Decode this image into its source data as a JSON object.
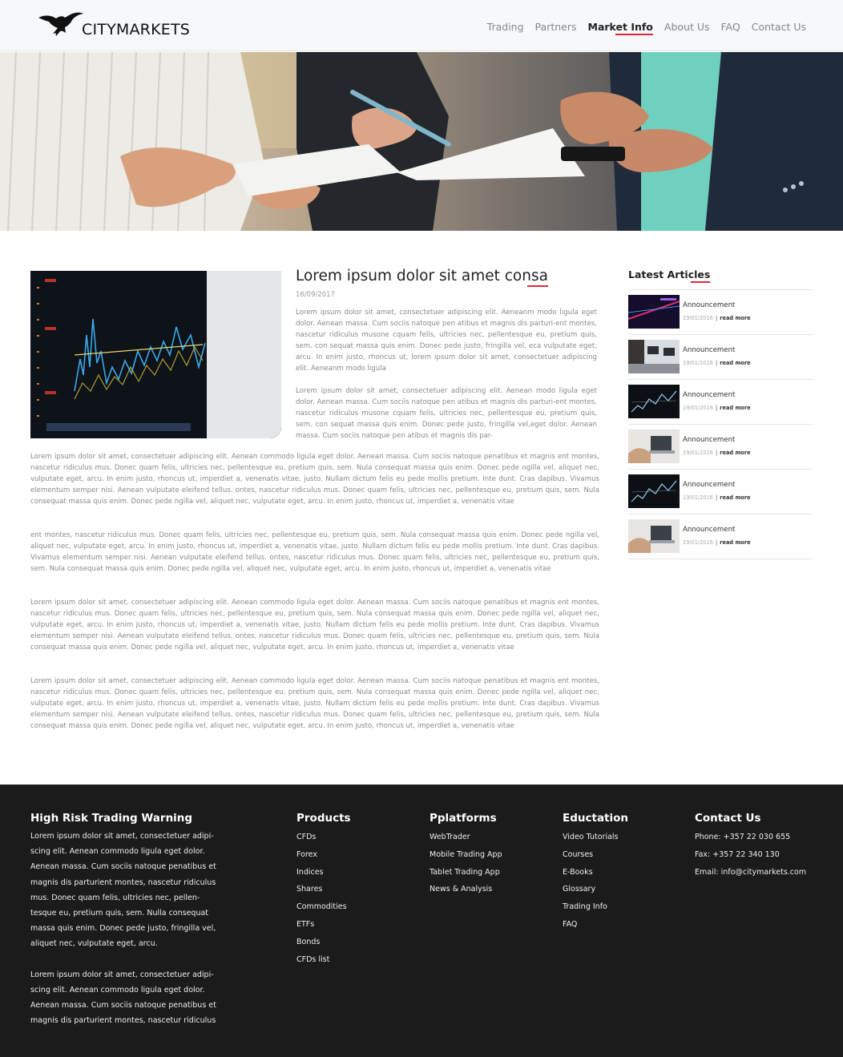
{
  "header": {
    "logo_text": "CITYMARKETS",
    "nav": [
      {
        "label": "Trading",
        "active": false
      },
      {
        "label": "Partners",
        "active": false
      },
      {
        "label": "Market Info",
        "active": true
      },
      {
        "label": "About Us",
        "active": false
      },
      {
        "label": "FAQ",
        "active": false
      },
      {
        "label": "Contact Us",
        "active": false
      }
    ]
  },
  "colors": {
    "accent": "#e0263a",
    "footer_bg": "#1b1b1b",
    "header_bg": "#f7f8fa"
  },
  "article": {
    "title": "Lorem ipsum dolor sit amet consa",
    "date": "16/09/2017",
    "intro1": "Lorem ipsum dolor sit amet, consectetuer adipiscing elit. Aeneanm modo ligula eget dolor. Aenean massa. Cum sociis natoque pen atibus et magnis dis parturi-ent montes, nascetur ridiculus musone cquam felis, ultricies nec, pellentesque eu, pretium quis, sem. con sequat massa quis enim. Donec pede justo, fringilla vel, eca vulputate eget, arcu. In enim justo, rhoncus ut, lorem ipsum dolor sit amet, consectetuer adipiscing elit. Aeneanm modo ligula",
    "intro2": "Lorem ipsum dolor sit amet, consectetuer adipiscing elit. Aenean  modo ligula eget dolor. Aenean massa. Cum sociis natoque pen atibus et magnis dis parturi-ent montes, nascetur ridiculus musone cquam felis, ultricies nec, pellentesque eu, pretium quis, sem. con sequat massa quis enim. Donec pede justo, fringilla vel,eget dolor. Aenean massa. Cum sociis natoque pen atibus et magnis dis par-",
    "body1": "Lorem ipsum dolor sit amet, consectetuer adipiscing elit. Aenean commodo ligula eget dolor. Aenean massa. Cum sociis natoque penatibus et magnis ent montes, nascetur ridiculus mus. Donec quam felis, ultricies nec, pellentesque eu, pretium quis, sem. Nula consequat massa quis enim. Donec pede ngilla vel, aliquet nec, vulputate eget, arcu. In enim justo, rhoncus ut, imperdiet a, venenatis vitae, justo. Nullam dictum felis eu pede mollis pretium. Inte dunt. Cras dapibus. Vivamus elementum semper nisi. Aenean vulputate eleifend tellus. ontes, nascetur ridiculus mus. Donec quam felis, ultricies nec, pellentesque eu, pretium quis, sem. Nula consequat massa quis enim. Donec pede ngilla vel, aliquet nec, vulputate eget, arcu. In enim justo, rhoncus ut, imperdiet a, venenatis vitae",
    "body2": "ent montes, nascetur ridiculus mus. Donec quam felis, ultricies nec, pellentesque eu, pretium quis, sem. Nula consequat massa quis enim. Donec pede ngilla vel, aliquet nec, vulputate eget, arcu. In enim justo, rhoncus ut, imperdiet a, venenatis vitae, justo. Nullam dictum felis eu pede mollis pretium. Inte dunt. Cras dapibus. Vivamus elementum semper nisi. Aenean vulputate eleifend tellus. ontes, nascetur ridiculus mus. Donec quam felis, ultricies nec, pellentesque eu, pretium quis, sem. Nula consequat massa quis enim. Donec pede ngilla vel, aliquet nec, vulputate eget, arcu. In enim justo, rhoncus ut, imperdiet a, venenatis vitae",
    "body3": "Lorem ipsum dolor sit amet, consectetuer adipiscing elit. Aenean commodo ligula eget dolor. Aenean massa. Cum sociis natoque penatibus et magnis ent montes, nascetur ridiculus mus. Donec quam felis, ultricies nec, pellentesque eu, pretium quis, sem. Nula consequat massa quis enim. Donec pede ngilla vel, aliquet nec, vulputate eget, arcu. In enim justo, rhoncus ut, imperdiet a, venenatis vitae, justo. Nullam dictum felis eu pede mollis pretium. Inte dunt. Cras dapibus. Vivamus elementum semper nisi. Aenean vulputate eleifend tellus. ontes, nascetur ridiculus mus. Donec quam felis, ultricies nec, pellentesque eu, pretium quis, sem. Nula consequat massa quis enim. Donec pede ngilla vel, aliquet nec, vulputate eget, arcu. In enim justo, rhoncus ut, imperdiet a, venenatis vitae",
    "body4": "Lorem ipsum dolor sit amet, consectetuer adipiscing elit. Aenean commodo ligula eget dolor. Aenean massa. Cum sociis natoque penatibus et magnis ent montes, nascetur ridiculus mus. Donec quam felis, ultricies nec, pellentesque eu, pretium quis, sem. Nula consequat massa quis enim. Donec pede ngilla vel, aliquet nec, vulputate eget, arcu. In enim justo, rhoncus ut, imperdiet a, venenatis vitae, justo. Nullam dictum felis eu pede mollis pretium. Inte dunt. Cras dapibus. Vivamus elementum semper nisi. Aenean vulputate eleifend tellus. ontes, nascetur ridiculus mus. Donec quam felis, ultricies nec, pellentesque eu, pretium quis, sem. Nula consequat massa quis enim. Donec pede ngilla vel, aliquet nec, vulputate eget, arcu. In enim justo, rhoncus ut, imperdiet a, venenatis vitae"
  },
  "sidebar": {
    "title": "Latest Articles",
    "items": [
      {
        "label": "Announcement",
        "date": "19/01/2016",
        "more": "read more",
        "thumb": "trading-screen"
      },
      {
        "label": "Announcement",
        "date": "19/01/2016",
        "more": "read more",
        "thumb": "office-desks"
      },
      {
        "label": "Announcement",
        "date": "19/01/2016",
        "more": "read more",
        "thumb": "chart-screen"
      },
      {
        "label": "Announcement",
        "date": "19/01/2016",
        "more": "read more",
        "thumb": "laptop-hands"
      },
      {
        "label": "Announcement",
        "date": "19/01/2016",
        "more": "read more",
        "thumb": "chart-screen"
      },
      {
        "label": "Announcement",
        "date": "19/01/2016",
        "more": "read more",
        "thumb": "laptop-hands"
      }
    ]
  },
  "footer": {
    "warning": {
      "title": "High Risk Trading Warning",
      "p1": "Lorem ipsum dolor sit amet, consectetuer adipi-scing elit. Aenean commodo ligula eget dolor. Aenean massa. Cum sociis natoque penatibus et magnis dis parturient montes, nascetur ridiculus mus. Donec quam felis, ultricies nec, pellen-tesque eu, pretium quis, sem. Nulla consequat massa quis enim. Donec pede justo, fringilla vel, aliquet nec, vulputate eget, arcu.",
      "p2": "Lorem ipsum dolor sit amet, consectetuer adipi-scing elit. Aenean commodo ligula eget dolor. Aenean massa. Cum sociis natoque penatibus et magnis dis parturient montes, nascetur ridiculus"
    },
    "products": {
      "title": "Products",
      "links": [
        "CFDs",
        "Forex",
        "Indices",
        "Shares",
        "Commodities",
        "ETFs",
        "Bonds",
        "CFDs list"
      ]
    },
    "platforms": {
      "title": "Pplatforms",
      "links": [
        "WebTrader",
        "Mobile Trading App",
        "Tablet Trading App",
        "News & Analysis"
      ]
    },
    "education": {
      "title": "Eductation",
      "links": [
        "Video Tutorials",
        "Courses",
        "E-Books",
        "Glossary",
        "Trading Info",
        "FAQ"
      ]
    },
    "contact": {
      "title": "Contact Us",
      "links": [
        "Phone: +357 22 030 655",
        "Fax: +357 22 340 130",
        "Email: info@citymarkets.com"
      ]
    }
  }
}
